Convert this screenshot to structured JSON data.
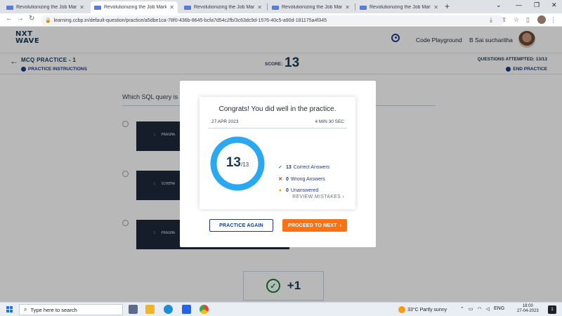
{
  "browser": {
    "tabs": [
      {
        "title": "Revolutionizing the Job Market |",
        "active": false
      },
      {
        "title": "Revolutionizing the Job Market |",
        "active": true
      },
      {
        "title": "Revolutionizing the Job Market |",
        "active": false
      },
      {
        "title": "Revolutionizing the Job Market |",
        "active": false
      },
      {
        "title": "Revolutionizing the Job Market |",
        "active": false
      }
    ],
    "new_tab": "+",
    "url": "learning.ccbp.in/default-question/practice/a5dbe1ca-78f0-436b-8645-bcfa7d54c2fb/3c63dc9d-1576-40c5-a90d-181175a4f345"
  },
  "header": {
    "logo_line1": "NXT",
    "logo_line2": "WAVE",
    "code_playground": "Code Playground",
    "user_name": "B Sai sucharitha"
  },
  "practice": {
    "title": "MCQ PRACTICE - 1",
    "instructions": "PRACTICE INSTRUCTIONS",
    "score_label": "SCORE:",
    "score": "13",
    "attempted": "QUESTIONS ATTEMPTED: 13/13",
    "end_practice": "END PRACTICE"
  },
  "question": {
    "text": "Which SQL query is u",
    "options": [
      "PRAGMA",
      "SCHEMA",
      "PRAGMA"
    ],
    "line_no": "1",
    "plus_score": "+1"
  },
  "modal": {
    "congrats": "Congrats! You did well in the practice.",
    "date": "27 APR 2023",
    "duration": "4 MIN 30 SEC",
    "score": "13",
    "total": "/13",
    "correct_count": "13",
    "correct_label": "Correct Answers",
    "wrong_count": "0",
    "wrong_label": "Wrong Answers",
    "unanswered_count": "0",
    "unanswered_label": "Unanswered",
    "review": "REVIEW MISTAKES",
    "practice_again": "PRACTICE AGAIN",
    "proceed": "PROCEED TO NEXT",
    "ring_fraction": 1.0,
    "ring_color": "#2aa8f2"
  },
  "taskbar": {
    "search_placeholder": "Type here to search",
    "weather": "33°C  Partly sunny",
    "lang": "ENG",
    "time": "18:00",
    "date": "27-04-2023",
    "notifications": "1"
  },
  "colors": {
    "accent": "#1e3a8a",
    "orange": "#f97316",
    "correct": "#16a34a",
    "wrong": "#dc2626",
    "unanswered": "#f59e0b"
  }
}
